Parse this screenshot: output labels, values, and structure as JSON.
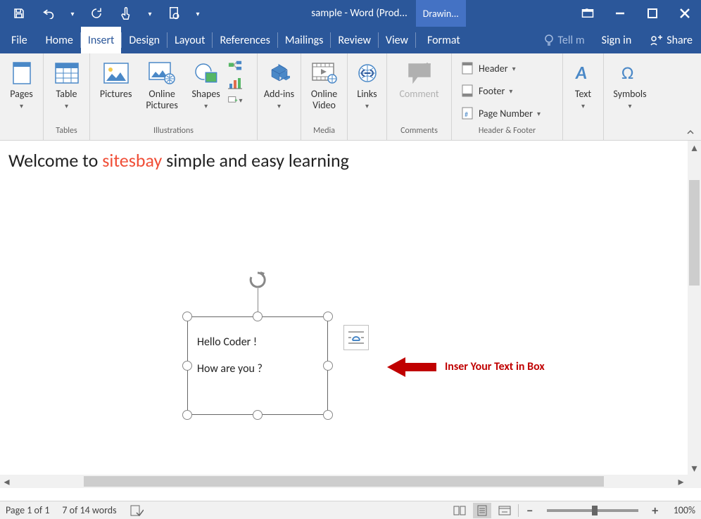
{
  "titlebar": {
    "document_title": "sample - Word (Prod...",
    "context_tab": "Drawin..."
  },
  "menubar": {
    "file": "File",
    "tabs": [
      "Home",
      "Insert",
      "Design",
      "Layout",
      "References",
      "Mailings",
      "Review",
      "View"
    ],
    "active_index": 1,
    "format": "Format",
    "tell_me": "Tell m",
    "sign_in": "Sign in",
    "share": "Share"
  },
  "ribbon": {
    "pages": {
      "label": "Pages"
    },
    "tables": {
      "btn": "Table",
      "group": "Tables"
    },
    "illustrations": {
      "group": "Illustrations",
      "pictures": "Pictures",
      "online_pictures": "Online Pictures",
      "shapes": "Shapes"
    },
    "addins": {
      "label": "Add-ins"
    },
    "media": {
      "group": "Media",
      "online_video": "Online Video"
    },
    "links": {
      "label": "Links"
    },
    "comments": {
      "group": "Comments",
      "comment": "Comment"
    },
    "header_footer": {
      "group": "Header & Footer",
      "header": "Header",
      "footer": "Footer",
      "page_number": "Page Number"
    },
    "text": {
      "label": "Text"
    },
    "symbols": {
      "label": "Symbols"
    }
  },
  "document": {
    "heading_pre": "Welcome to ",
    "heading_brand": "sitesbay",
    "heading_post": " simple and easy learning",
    "textbox_line1": "Hello Coder !",
    "textbox_line2": "How are you ?",
    "callout": "Inser Your Text in Box"
  },
  "statusbar": {
    "page": "Page 1 of 1",
    "words": "7 of 14 words",
    "zoom": "100%"
  }
}
